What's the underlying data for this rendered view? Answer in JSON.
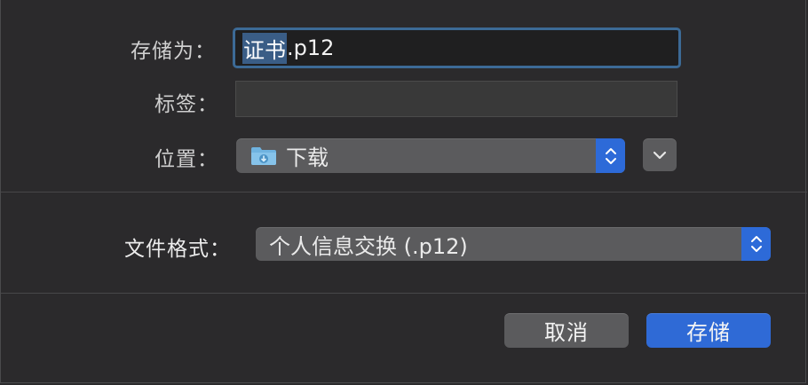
{
  "dialog": {
    "save_as_label": "存储为：",
    "tags_label": "标签：",
    "location_label": "位置：",
    "format_label": "文件格式："
  },
  "filename": {
    "selected": "证书",
    "rest": ".p12"
  },
  "tags": {
    "value": ""
  },
  "location": {
    "selected": "下载",
    "icon": "downloads-folder-icon"
  },
  "format": {
    "selected": "个人信息交换 (.p12)"
  },
  "buttons": {
    "cancel": "取消",
    "save": "存储"
  },
  "colors": {
    "accent": "#2f6ad6",
    "focus_ring": "#3c6a96",
    "selection": "#3a5d86"
  }
}
